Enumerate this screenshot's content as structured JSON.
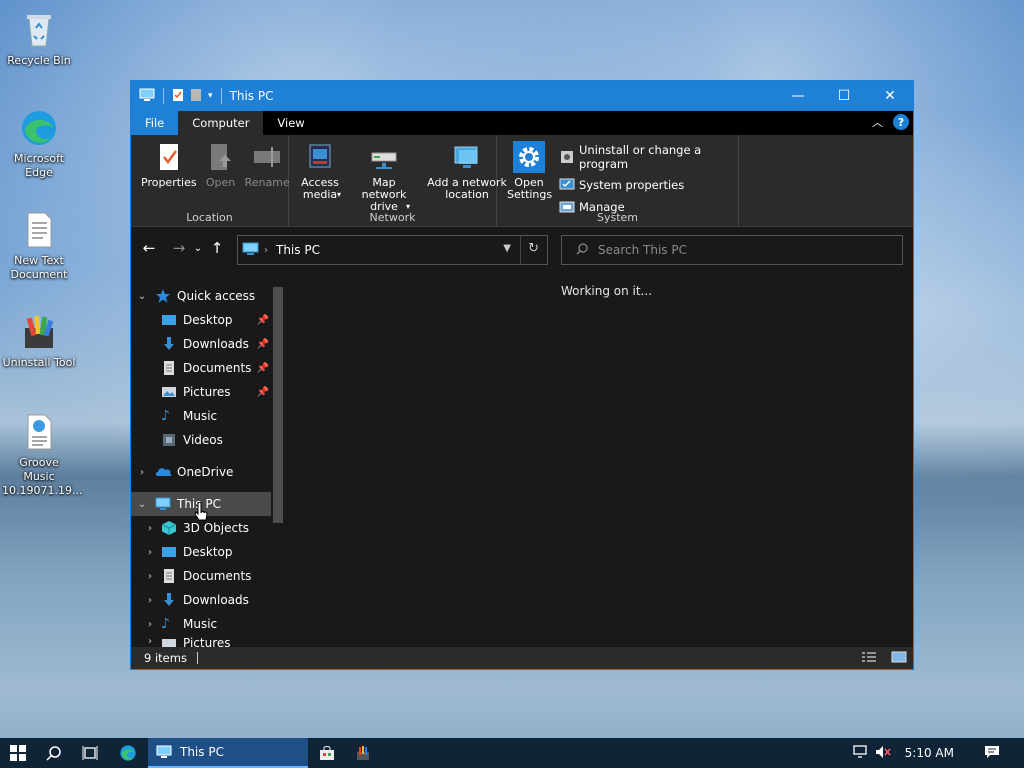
{
  "desktop": {
    "icons": [
      {
        "label": "Recycle Bin"
      },
      {
        "label": "Microsoft Edge"
      },
      {
        "label": "New Text Document"
      },
      {
        "label": "Uninstall Tool"
      },
      {
        "label": "Groove Music 10.19071.19..."
      }
    ]
  },
  "window": {
    "title": "This PC",
    "ribbon_tabs": {
      "file": "File",
      "computer": "Computer",
      "view": "View"
    },
    "ribbon": {
      "location": {
        "name": "Location",
        "properties": "Properties",
        "open": "Open",
        "rename": "Rename"
      },
      "network": {
        "name": "Network",
        "access_media": "Access media",
        "map_network_drive": "Map network drive",
        "add_network_location": "Add a network location"
      },
      "system": {
        "name": "System",
        "open_settings": "Open Settings",
        "uninstall": "Uninstall or change a program",
        "system_properties": "System properties",
        "manage": "Manage"
      }
    },
    "address": {
      "path": "This PC"
    },
    "search": {
      "placeholder": "Search This PC"
    },
    "nav": {
      "quick_access": "Quick access",
      "qa_items": [
        "Desktop",
        "Downloads",
        "Documents",
        "Pictures",
        "Music",
        "Videos"
      ],
      "onedrive": "OneDrive",
      "this_pc": "This PC",
      "pc_items": [
        "3D Objects",
        "Desktop",
        "Documents",
        "Downloads",
        "Music",
        "Pictures"
      ]
    },
    "content": {
      "status_message": "Working on it..."
    },
    "status": {
      "items_count": "9 items"
    }
  },
  "taskbar": {
    "app_label": "This PC",
    "clock": "5:10 AM"
  },
  "colors": {
    "accent": "#1e80d6",
    "window_bg": "#191919",
    "ribbon_bg": "#2b2b2b"
  }
}
